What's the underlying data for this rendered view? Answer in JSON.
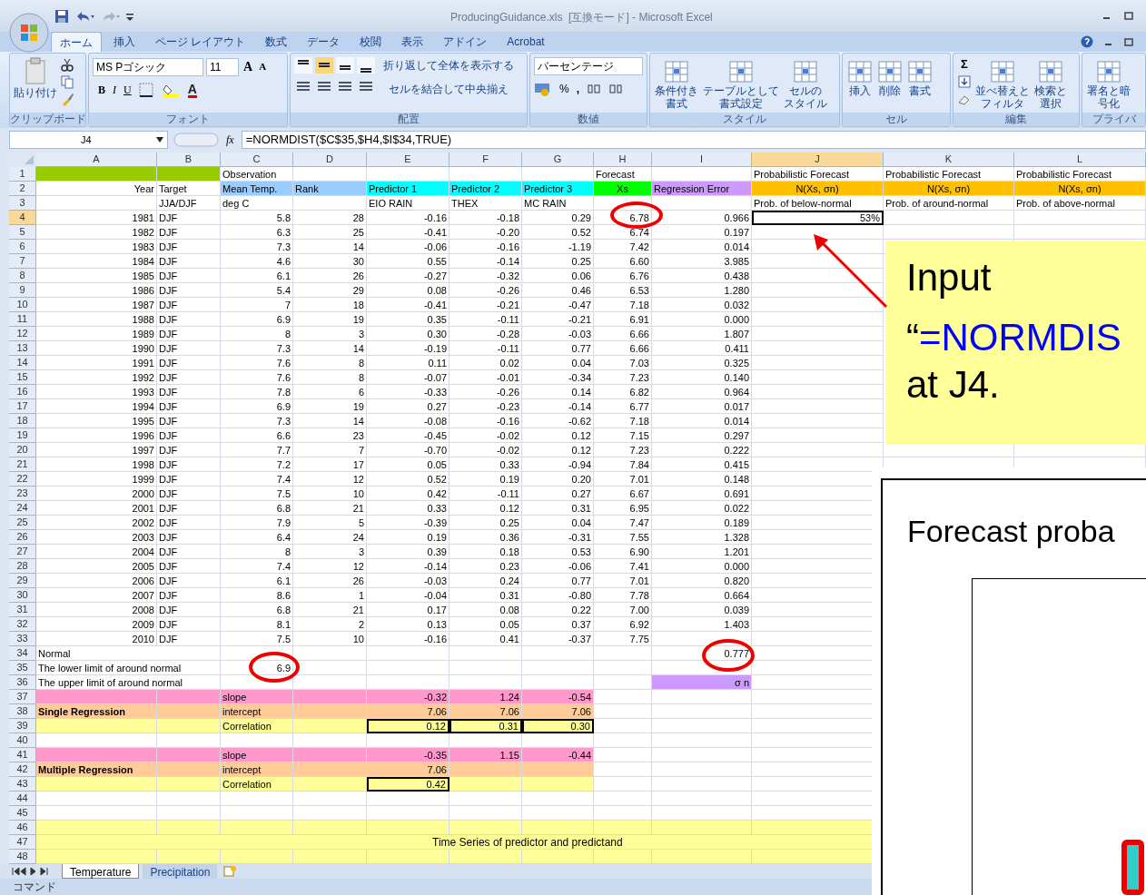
{
  "window": {
    "title": "ProducingGuidance.xls  [互換モード] - Microsoft Excel"
  },
  "tabs": [
    {
      "label": "ホーム",
      "selected": true
    },
    {
      "label": "挿入",
      "selected": false
    },
    {
      "label": "ページ レイアウト",
      "selected": false
    },
    {
      "label": "数式",
      "selected": false
    },
    {
      "label": "データ",
      "selected": false
    },
    {
      "label": "校閲",
      "selected": false
    },
    {
      "label": "表示",
      "selected": false
    },
    {
      "label": "アドイン",
      "selected": false
    },
    {
      "label": "Acrobat",
      "selected": false
    }
  ],
  "ribbon": [
    {
      "kind": "clipboard",
      "label": "クリップボード",
      "paste": "貼り付け"
    },
    {
      "kind": "font",
      "label": "フォント",
      "font": "MS Pゴシック",
      "size": "11",
      "grow": "A",
      "shrink": "A",
      "styles": [
        "B",
        "I",
        "U"
      ],
      "color_letter": "A"
    },
    {
      "kind": "alignment",
      "label": "配置",
      "wrap": "折り返して全体を表示する",
      "merge": "セルを結合して中央揃え"
    },
    {
      "kind": "number",
      "label": "数値",
      "format": "パーセンテージ",
      "percent": "%",
      "comma": ","
    },
    {
      "kind": "large",
      "label": "スタイル",
      "buttons": [
        [
          "条件付き",
          "書式"
        ],
        [
          "テーブルとして",
          "書式設定"
        ],
        [
          "セルの",
          "スタイル"
        ]
      ]
    },
    {
      "kind": "large",
      "label": "セル",
      "buttons": [
        [
          "挿入"
        ],
        [
          "削除"
        ],
        [
          "書式"
        ]
      ]
    },
    {
      "kind": "editing",
      "label": "編集",
      "sigma": "Σ",
      "buttons": [
        [
          "並べ替えと",
          "フィルタ"
        ],
        [
          "検索と",
          "選択"
        ]
      ]
    },
    {
      "kind": "large",
      "label": "プライバ",
      "buttons": [
        [
          "署名と暗",
          "号化"
        ]
      ]
    }
  ],
  "formula_bar": {
    "name_box": "J4",
    "fx": "fx",
    "formula": "=NORMDIST($C$35,$H4,$I$34,TRUE)"
  },
  "columns": [
    {
      "label": "A",
      "selected": false
    },
    {
      "label": "B",
      "selected": false
    },
    {
      "label": "C",
      "selected": false
    },
    {
      "label": "D",
      "selected": false
    },
    {
      "label": "E",
      "selected": false
    },
    {
      "label": "F",
      "selected": false
    },
    {
      "label": "G",
      "selected": false
    },
    {
      "label": "H",
      "selected": false
    },
    {
      "label": "I",
      "selected": false
    },
    {
      "label": "J",
      "selected": true
    },
    {
      "label": "K",
      "selected": false
    },
    {
      "label": "L",
      "selected": false
    }
  ],
  "rows": [
    {
      "n": "1",
      "selected": false,
      "cells": {
        "C": "Observation",
        "H": "Forecast",
        "J": "Probabilistic Forecast",
        "K": "Probabilistic Forecast",
        "L": "Probabilistic Forecast"
      }
    },
    {
      "n": "2",
      "selected": false,
      "cells": {
        "A": "Year",
        "B": "Target",
        "C": "Mean Temp.",
        "D": "Rank",
        "E": "Predictor 1",
        "F": "Predictor 2",
        "G": "Predictor 3",
        "H": "Xs",
        "I": "Regression Error",
        "J": "N(Xs, σn)",
        "K": "N(Xs, σn)",
        "L": "N(Xs, σn)"
      }
    },
    {
      "n": "3",
      "selected": false,
      "cells": {
        "B": "JJA/DJF",
        "C": "deg C",
        "E": "EIO RAIN",
        "F": "THEX",
        "G": "MC RAIN",
        "J": "Prob. of below-normal",
        "K": "Prob. of around-normal",
        "L": "Prob. of above-normal"
      }
    },
    {
      "n": "4",
      "selected": true,
      "cells": {
        "A": "1981",
        "B": "DJF",
        "C": "5.8",
        "D": "28",
        "E": "-0.16",
        "F": "-0.18",
        "G": "0.29",
        "H": "6.78",
        "I": "0.966",
        "J": "53%"
      }
    },
    {
      "n": "5",
      "selected": false,
      "cells": {
        "A": "1982",
        "B": "DJF",
        "C": "6.3",
        "D": "25",
        "E": "-0.41",
        "F": "-0.20",
        "G": "0.52",
        "H": "6.74",
        "I": "0.197"
      }
    },
    {
      "n": "6",
      "selected": false,
      "cells": {
        "A": "1983",
        "B": "DJF",
        "C": "7.3",
        "D": "14",
        "E": "-0.06",
        "F": "-0.16",
        "G": "-1.19",
        "H": "7.42",
        "I": "0.014"
      }
    },
    {
      "n": "7",
      "selected": false,
      "cells": {
        "A": "1984",
        "B": "DJF",
        "C": "4.6",
        "D": "30",
        "E": "0.55",
        "F": "-0.14",
        "G": "0.25",
        "H": "6.60",
        "I": "3.985"
      }
    },
    {
      "n": "8",
      "selected": false,
      "cells": {
        "A": "1985",
        "B": "DJF",
        "C": "6.1",
        "D": "26",
        "E": "-0.27",
        "F": "-0.32",
        "G": "0.06",
        "H": "6.76",
        "I": "0.438"
      }
    },
    {
      "n": "9",
      "selected": false,
      "cells": {
        "A": "1986",
        "B": "DJF",
        "C": "5.4",
        "D": "29",
        "E": "0.08",
        "F": "-0.26",
        "G": "0.46",
        "H": "6.53",
        "I": "1.280"
      }
    },
    {
      "n": "10",
      "selected": false,
      "cells": {
        "A": "1987",
        "B": "DJF",
        "C": "7",
        "D": "18",
        "E": "-0.41",
        "F": "-0.21",
        "G": "-0.47",
        "H": "7.18",
        "I": "0.032"
      }
    },
    {
      "n": "11",
      "selected": false,
      "cells": {
        "A": "1988",
        "B": "DJF",
        "C": "6.9",
        "D": "19",
        "E": "0.35",
        "F": "-0.11",
        "G": "-0.21",
        "H": "6.91",
        "I": "0.000"
      }
    },
    {
      "n": "12",
      "selected": false,
      "cells": {
        "A": "1989",
        "B": "DJF",
        "C": "8",
        "D": "3",
        "E": "0.30",
        "F": "-0.28",
        "G": "-0.03",
        "H": "6.66",
        "I": "1.807"
      }
    },
    {
      "n": "13",
      "selected": false,
      "cells": {
        "A": "1990",
        "B": "DJF",
        "C": "7.3",
        "D": "14",
        "E": "-0.19",
        "F": "-0.11",
        "G": "0.77",
        "H": "6.66",
        "I": "0.411"
      }
    },
    {
      "n": "14",
      "selected": false,
      "cells": {
        "A": "1991",
        "B": "DJF",
        "C": "7.6",
        "D": "8",
        "E": "0.11",
        "F": "0.02",
        "G": "0.04",
        "H": "7.03",
        "I": "0.325"
      }
    },
    {
      "n": "15",
      "selected": false,
      "cells": {
        "A": "1992",
        "B": "DJF",
        "C": "7.6",
        "D": "8",
        "E": "-0.07",
        "F": "-0.01",
        "G": "-0.34",
        "H": "7.23",
        "I": "0.140"
      }
    },
    {
      "n": "16",
      "selected": false,
      "cells": {
        "A": "1993",
        "B": "DJF",
        "C": "7.8",
        "D": "6",
        "E": "-0.33",
        "F": "-0.26",
        "G": "0.14",
        "H": "6.82",
        "I": "0.964"
      }
    },
    {
      "n": "17",
      "selected": false,
      "cells": {
        "A": "1994",
        "B": "DJF",
        "C": "6.9",
        "D": "19",
        "E": "0.27",
        "F": "-0.23",
        "G": "-0.14",
        "H": "6.77",
        "I": "0.017"
      }
    },
    {
      "n": "18",
      "selected": false,
      "cells": {
        "A": "1995",
        "B": "DJF",
        "C": "7.3",
        "D": "14",
        "E": "-0.08",
        "F": "-0.16",
        "G": "-0.62",
        "H": "7.18",
        "I": "0.014"
      }
    },
    {
      "n": "19",
      "selected": false,
      "cells": {
        "A": "1996",
        "B": "DJF",
        "C": "6.6",
        "D": "23",
        "E": "-0.45",
        "F": "-0.02",
        "G": "0.12",
        "H": "7.15",
        "I": "0.297"
      }
    },
    {
      "n": "20",
      "selected": false,
      "cells": {
        "A": "1997",
        "B": "DJF",
        "C": "7.7",
        "D": "7",
        "E": "-0.70",
        "F": "-0.02",
        "G": "0.12",
        "H": "7.23",
        "I": "0.222"
      }
    },
    {
      "n": "21",
      "selected": false,
      "cells": {
        "A": "1998",
        "B": "DJF",
        "C": "7.2",
        "D": "17",
        "E": "0.05",
        "F": "0.33",
        "G": "-0.94",
        "H": "7.84",
        "I": "0.415"
      }
    },
    {
      "n": "22",
      "selected": false,
      "cells": {
        "A": "1999",
        "B": "DJF",
        "C": "7.4",
        "D": "12",
        "E": "0.52",
        "F": "0.19",
        "G": "0.20",
        "H": "7.01",
        "I": "0.148"
      }
    },
    {
      "n": "23",
      "selected": false,
      "cells": {
        "A": "2000",
        "B": "DJF",
        "C": "7.5",
        "D": "10",
        "E": "0.42",
        "F": "-0.11",
        "G": "0.27",
        "H": "6.67",
        "I": "0.691"
      }
    },
    {
      "n": "24",
      "selected": false,
      "cells": {
        "A": "2001",
        "B": "DJF",
        "C": "6.8",
        "D": "21",
        "E": "0.33",
        "F": "0.12",
        "G": "0.31",
        "H": "6.95",
        "I": "0.022"
      }
    },
    {
      "n": "25",
      "selected": false,
      "cells": {
        "A": "2002",
        "B": "DJF",
        "C": "7.9",
        "D": "5",
        "E": "-0.39",
        "F": "0.25",
        "G": "0.04",
        "H": "7.47",
        "I": "0.189"
      }
    },
    {
      "n": "26",
      "selected": false,
      "cells": {
        "A": "2003",
        "B": "DJF",
        "C": "6.4",
        "D": "24",
        "E": "0.19",
        "F": "0.36",
        "G": "-0.31",
        "H": "7.55",
        "I": "1.328"
      }
    },
    {
      "n": "27",
      "selected": false,
      "cells": {
        "A": "2004",
        "B": "DJF",
        "C": "8",
        "D": "3",
        "E": "0.39",
        "F": "0.18",
        "G": "0.53",
        "H": "6.90",
        "I": "1.201"
      }
    },
    {
      "n": "28",
      "selected": false,
      "cells": {
        "A": "2005",
        "B": "DJF",
        "C": "7.4",
        "D": "12",
        "E": "-0.14",
        "F": "0.23",
        "G": "-0.06",
        "H": "7.41",
        "I": "0.000"
      }
    },
    {
      "n": "29",
      "selected": false,
      "cells": {
        "A": "2006",
        "B": "DJF",
        "C": "6.1",
        "D": "26",
        "E": "-0.03",
        "F": "0.24",
        "G": "0.77",
        "H": "7.01",
        "I": "0.820"
      }
    },
    {
      "n": "30",
      "selected": false,
      "cells": {
        "A": "2007",
        "B": "DJF",
        "C": "8.6",
        "D": "1",
        "E": "-0.04",
        "F": "0.31",
        "G": "-0.80",
        "H": "7.78",
        "I": "0.664"
      }
    },
    {
      "n": "31",
      "selected": false,
      "cells": {
        "A": "2008",
        "B": "DJF",
        "C": "6.8",
        "D": "21",
        "E": "0.17",
        "F": "0.08",
        "G": "0.22",
        "H": "7.00",
        "I": "0.039"
      }
    },
    {
      "n": "32",
      "selected": false,
      "cells": {
        "A": "2009",
        "B": "DJF",
        "C": "8.1",
        "D": "2",
        "E": "0.13",
        "F": "0.05",
        "G": "0.37",
        "H": "6.92",
        "I": "1.403"
      }
    },
    {
      "n": "33",
      "selected": false,
      "cells": {
        "A": "2010",
        "B": "DJF",
        "C": "7.5",
        "D": "10",
        "E": "-0.16",
        "F": "0.41",
        "G": "-0.37",
        "H": "7.75"
      }
    },
    {
      "n": "34",
      "selected": false,
      "cells": {
        "A": "Normal",
        "I": "0.777"
      }
    },
    {
      "n": "35",
      "selected": false,
      "cells": {
        "A": "The lower limit of around normal",
        "C": "6.9"
      }
    },
    {
      "n": "36",
      "selected": false,
      "cells": {
        "A": "The upper limit of around normal",
        "I": "σ n"
      }
    },
    {
      "n": "37",
      "selected": false,
      "cells": {
        "C": "slope",
        "E": "-0.32",
        "F": "1.24",
        "G": "-0.54"
      }
    },
    {
      "n": "38",
      "selected": false,
      "cells": {
        "A": "Single Regression",
        "C": "intercept",
        "E": "7.06",
        "F": "7.06",
        "G": "7.06"
      }
    },
    {
      "n": "39",
      "selected": false,
      "cells": {
        "C": "Correlation",
        "E": "0.12",
        "F": "0.31",
        "G": "0.30"
      }
    },
    {
      "n": "40",
      "selected": false,
      "cells": {}
    },
    {
      "n": "41",
      "selected": false,
      "cells": {
        "C": "slope",
        "E": "-0.35",
        "F": "1.15",
        "G": "-0.44"
      }
    },
    {
      "n": "42",
      "selected": false,
      "cells": {
        "A": "Multiple Regression",
        "C": "intercept",
        "E": "7.06"
      }
    },
    {
      "n": "43",
      "selected": false,
      "cells": {
        "C": "Correlation",
        "E": "0.42"
      }
    },
    {
      "n": "44",
      "selected": false,
      "cells": {}
    },
    {
      "n": "45",
      "selected": false,
      "cells": {}
    },
    {
      "n": "46",
      "selected": false,
      "cells": {}
    },
    {
      "n": "47",
      "selected": false,
      "banner": "Time Series of predictor and predictand"
    },
    {
      "n": "48",
      "selected": false,
      "cells": {}
    }
  ],
  "sheet_tabs": [
    {
      "label": "Temperature",
      "selected": true
    },
    {
      "label": "Precipitation",
      "selected": false
    }
  ],
  "status_bar": {
    "mode": "コマンド"
  },
  "callout": {
    "title": "Input",
    "quote": "“",
    "formula": "=NORMDIS",
    "tail": "at J4."
  },
  "figure_panel": {
    "title": "Forecast proba"
  }
}
